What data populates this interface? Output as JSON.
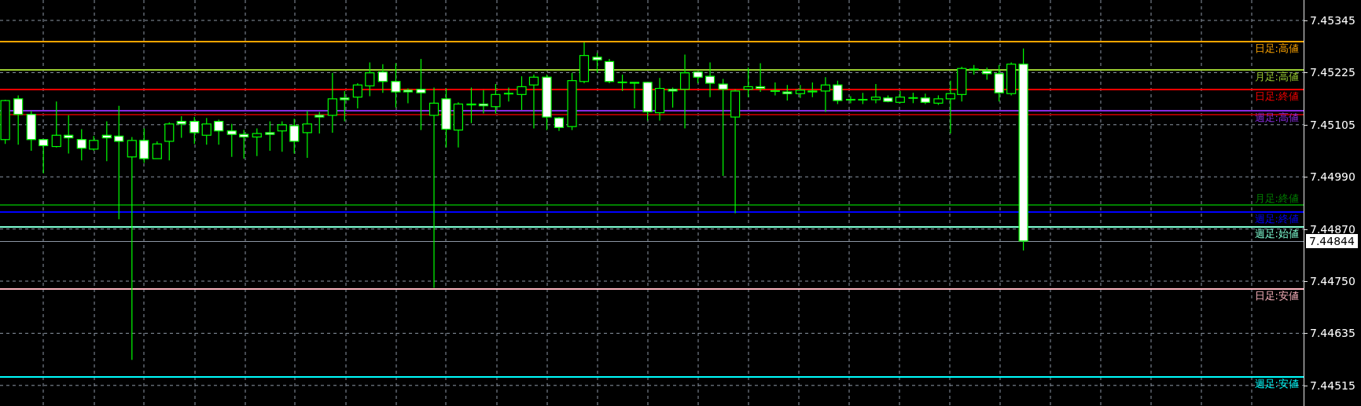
{
  "chart": {
    "lines": [
      {
        "label": "日足:高値",
        "color": "#ffa500"
      },
      {
        "label": "月足:高値",
        "color": "#9acd32"
      },
      {
        "label": "日足:終値",
        "color": "#ff0000"
      },
      {
        "label": "週足:高値",
        "color": "#8a2be2"
      },
      {
        "color": "#a00000"
      },
      {
        "label": "月足:終値",
        "color": "#008000"
      },
      {
        "label": "週足:終値",
        "color": "#0000ff"
      },
      {
        "label": "週足:始値",
        "color": "#7fffd4"
      },
      {
        "label": "日足:安値",
        "color": "#ffb6c1"
      },
      {
        "label": "週足:安値",
        "color": "#00ffff"
      }
    ],
    "price_axis": {
      "ticks": [
        "7.45345",
        "7.45225",
        "7.45105",
        "7.44990",
        "7.44870",
        "7.44750",
        "7.44635",
        "7.44515"
      ],
      "current_price": "7.44844"
    }
  }
}
